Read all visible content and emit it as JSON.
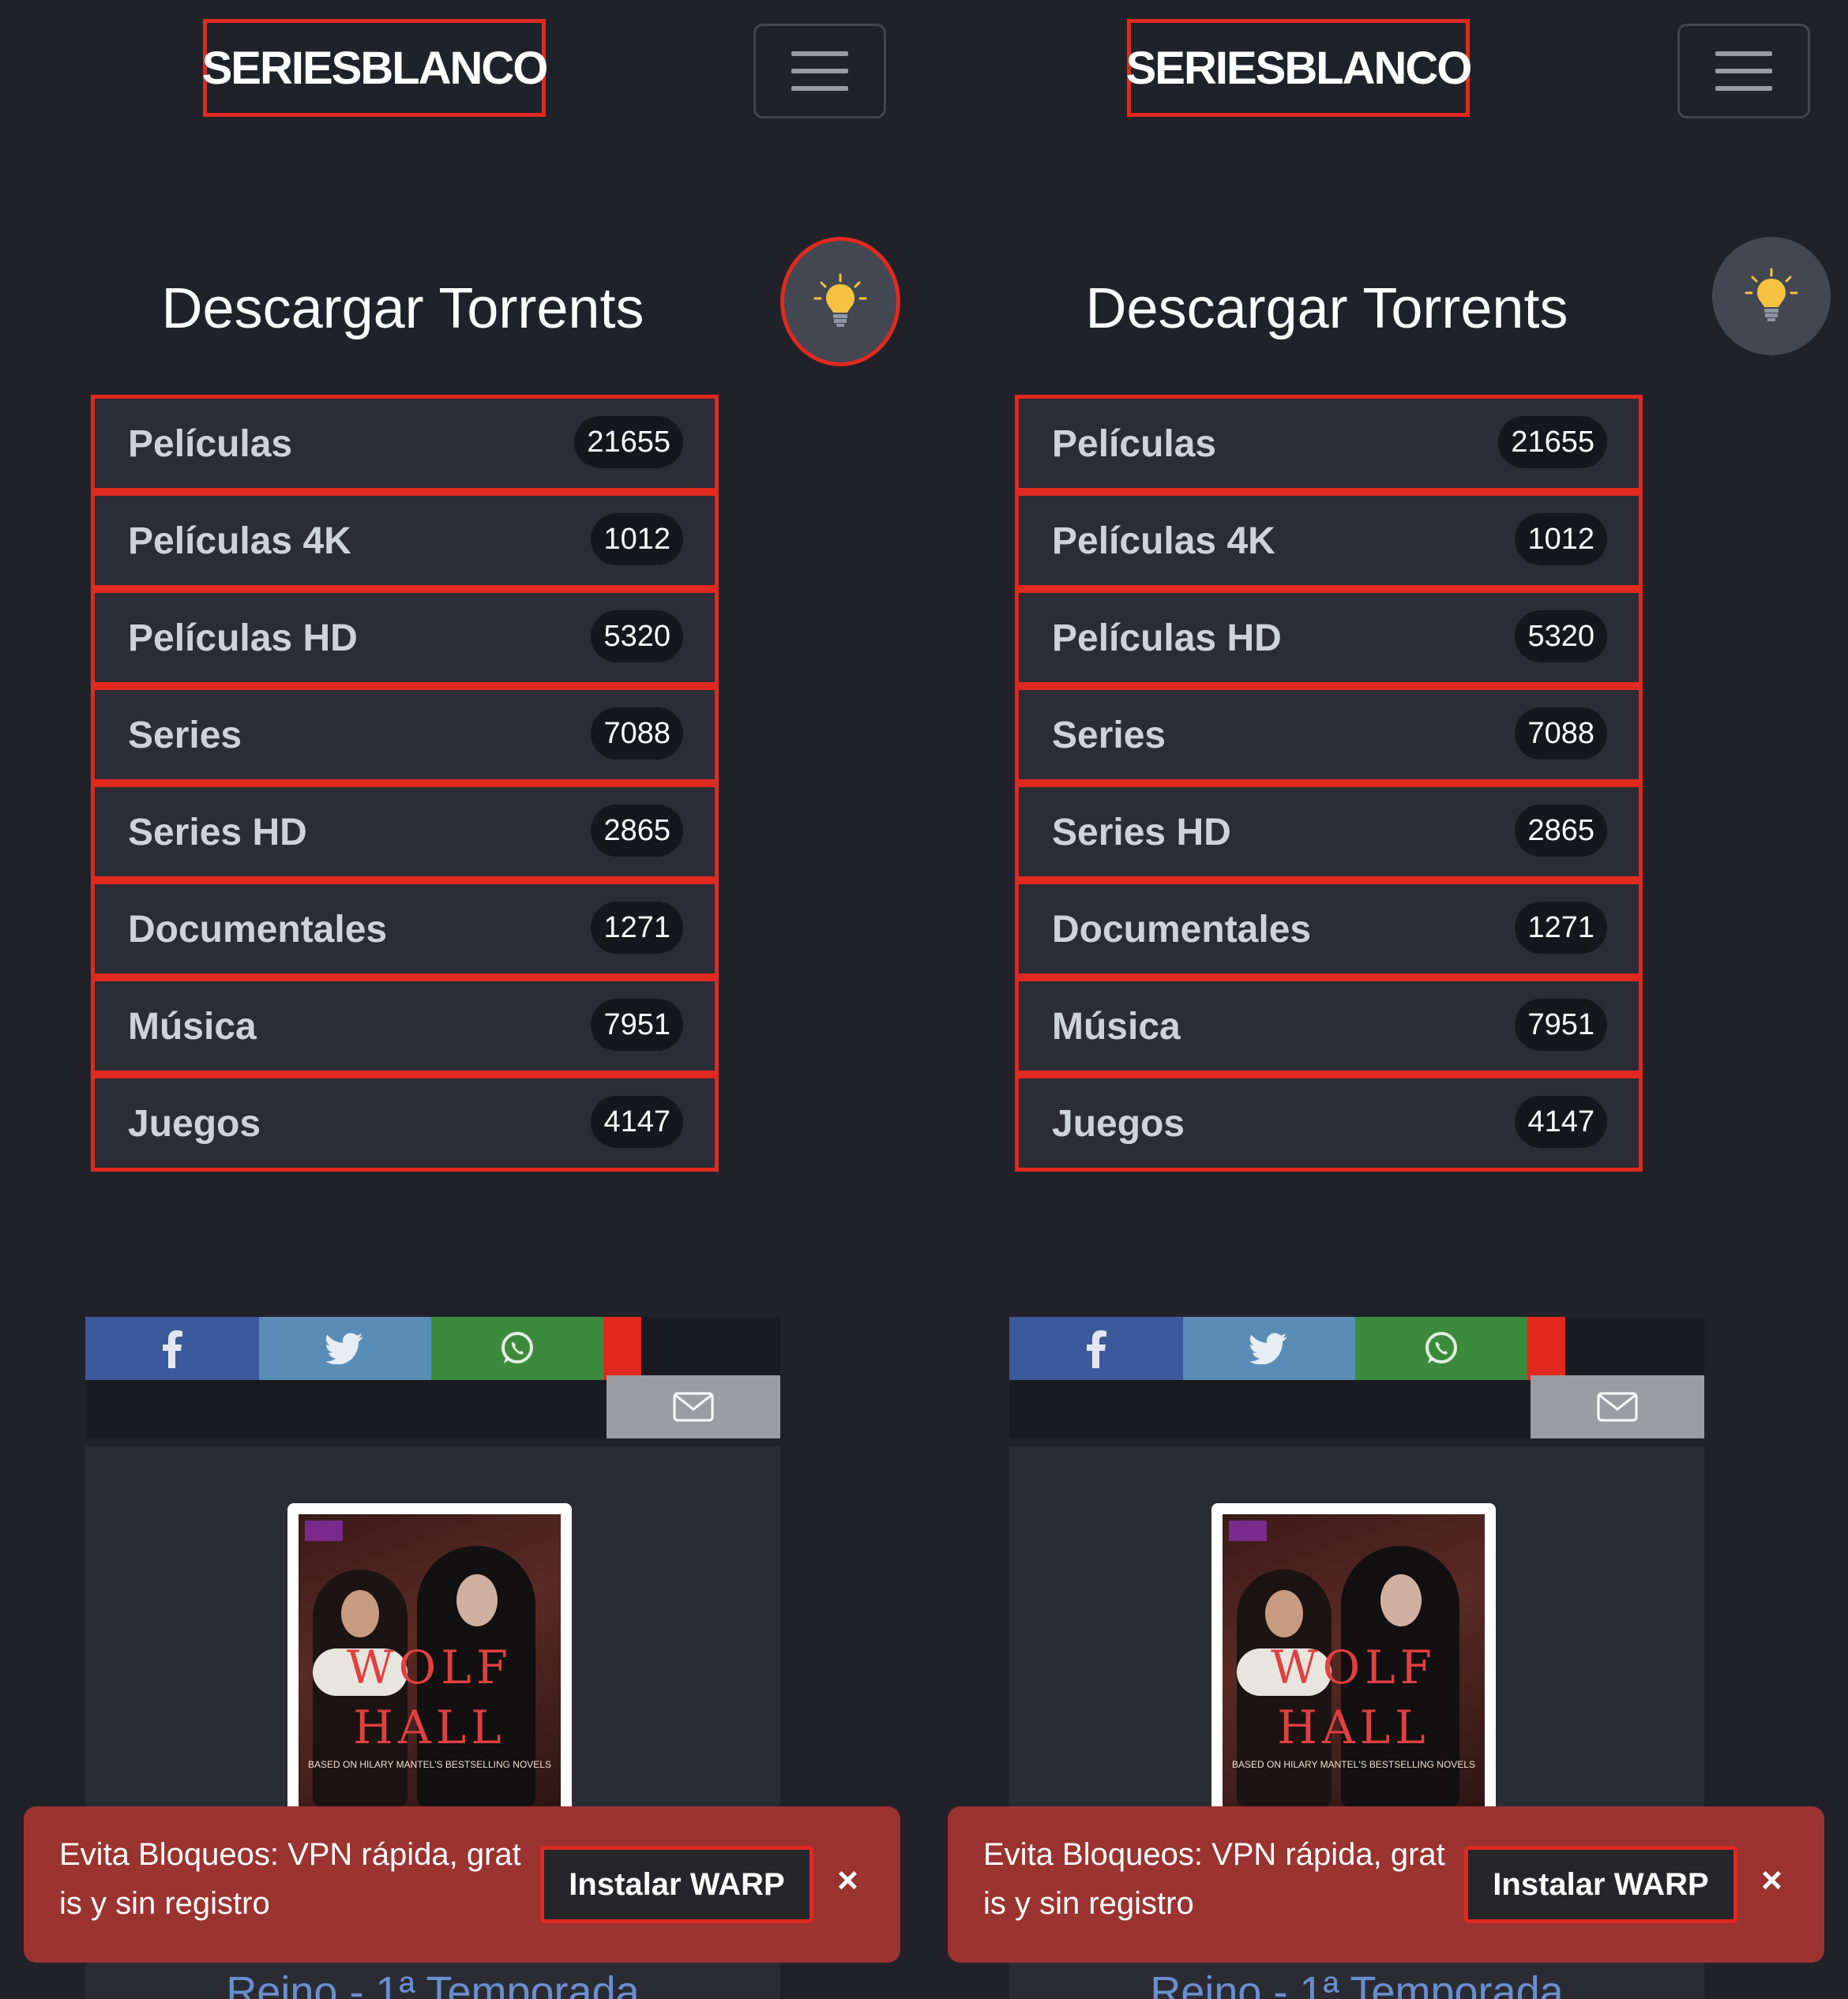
{
  "header": {
    "logo": "SERIESBLANCO",
    "menu_icon": "hamburger-menu-icon"
  },
  "theme_toggle": {
    "icon": "lightbulb-icon"
  },
  "categories": {
    "title": "Descargar Torrents",
    "items": [
      {
        "label": "Películas",
        "count": "21655"
      },
      {
        "label": "Películas 4K",
        "count": "1012"
      },
      {
        "label": "Películas HD",
        "count": "5320"
      },
      {
        "label": "Series",
        "count": "7088"
      },
      {
        "label": "Series HD",
        "count": "2865"
      },
      {
        "label": "Documentales",
        "count": "1271"
      },
      {
        "label": "Música",
        "count": "7951"
      },
      {
        "label": "Juegos",
        "count": "4147"
      }
    ]
  },
  "share": {
    "icons": [
      "facebook-icon",
      "twitter-icon",
      "whatsapp-icon",
      "mail-icon"
    ],
    "colors": {
      "facebook": "#3c5a99",
      "twitter": "#5a8db6",
      "whatsapp": "#3c8b3c",
      "mail": "#9b9da2",
      "accent": "#e0281c"
    }
  },
  "content": {
    "poster_title_line1": "WOLF",
    "poster_title_line2": "HALL",
    "poster_tagline": "BASED ON HILARY MANTEL'S BESTSELLING NOVELS",
    "title": "Reino - 1ª Temporada"
  },
  "banner": {
    "text": "Evita Bloqueos: VPN rápida, gratis y sin registro",
    "button": "Instalar WARP",
    "close": "×"
  },
  "colors": {
    "background": "#212229",
    "highlight_border": "#e02a20",
    "banner": "#9b3330",
    "link": "#6a8fd0"
  }
}
